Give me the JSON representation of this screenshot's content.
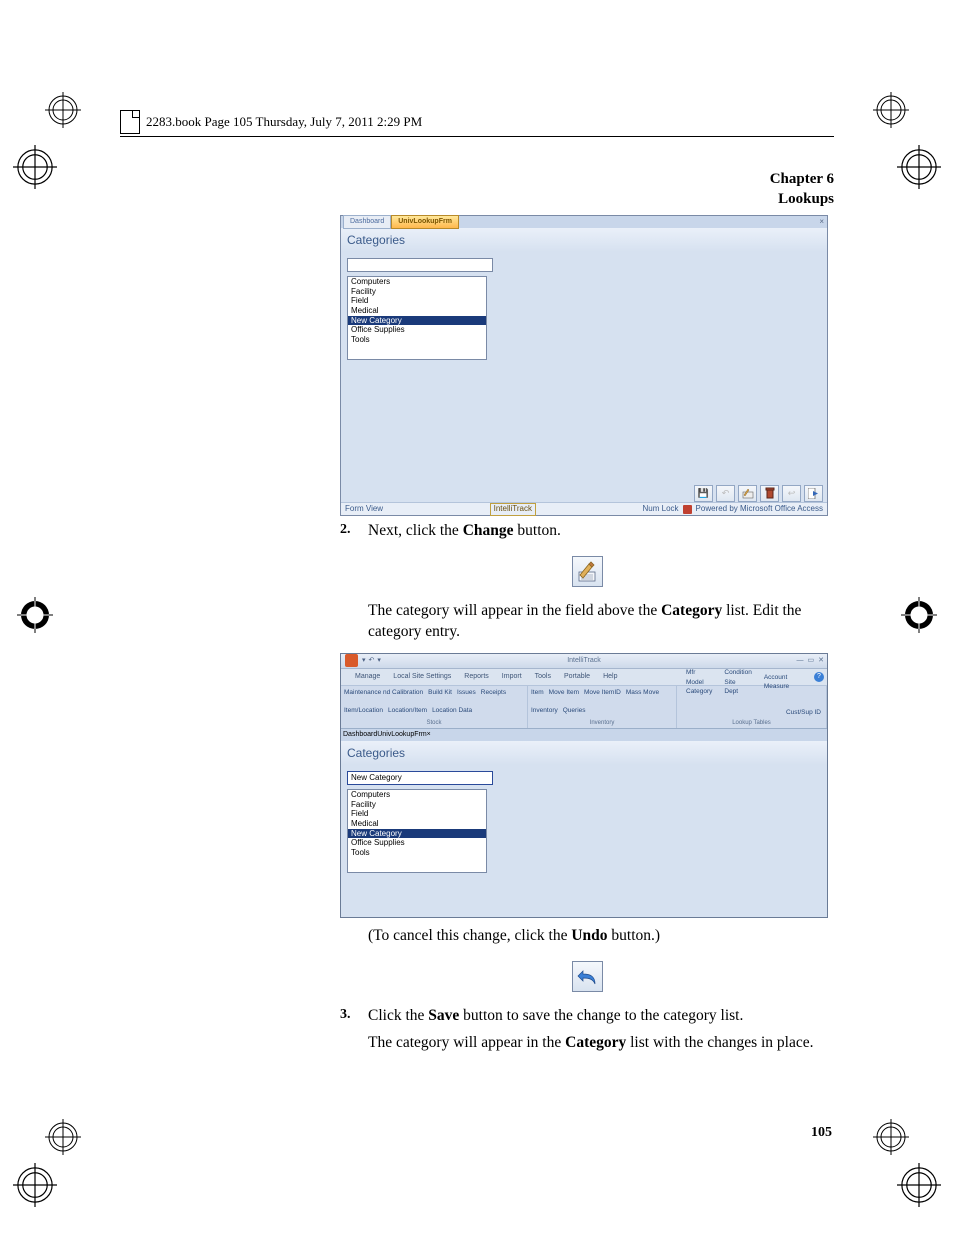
{
  "book_header": "2283.book  Page 105  Thursday, July 7, 2011  2:29 PM",
  "chapter": {
    "line1": "Chapter 6",
    "line2": "Lookups"
  },
  "page_number": "105",
  "screenshot1": {
    "tab_dashboard": "Dashboard",
    "tab_active": "UnivLookupFrm",
    "title": "Categories",
    "list": [
      "Computers",
      "Facility",
      "Field",
      "Medical",
      "New Category",
      "Office Supplies",
      "Tools"
    ],
    "selected_index": 4,
    "status_left": "Form View",
    "status_mid": "IntelliTrack",
    "status_numlock": "Num Lock",
    "status_powered": "Powered by Microsoft Office Access"
  },
  "step2": {
    "num": "2.",
    "text_pre": "Next, click the ",
    "text_bold": "Change",
    "text_post": " button.",
    "paragraph_pre": "The category will appear in the field above the ",
    "paragraph_bold": "Category",
    "paragraph_post": " list. Edit the category entry."
  },
  "screenshot2": {
    "app_title": "IntelliTrack",
    "menus": [
      "Manage",
      "Local Site Settings",
      "Reports",
      "Import",
      "Tools",
      "Portable",
      "Help"
    ],
    "ribbon": {
      "grp1": {
        "items": [
          "Maintenance nd Calibration",
          "Build Kit",
          "Issues",
          "Receipts",
          "Item/Location",
          "Location/Item",
          "Location Data"
        ],
        "name": "Stock"
      },
      "grp2": {
        "items": [
          "Item",
          "Move Item",
          "Move ItemID",
          "Mass Move",
          "Inventory",
          "Queries"
        ],
        "name": "Inventory"
      },
      "grp3": {
        "col1": [
          "Mfr",
          "Model",
          "Category"
        ],
        "col2": [
          "Condition",
          "Site",
          "Dept"
        ],
        "col3": [
          "Account",
          "Measure"
        ],
        "edge": "Cust/Sup ID",
        "name": "Lookup Tables"
      }
    },
    "tab_dashboard": "Dashboard",
    "tab_active": "UnivLookupFrm",
    "title": "Categories",
    "input_value": "New Category",
    "list": [
      "Computers",
      "Facility",
      "Field",
      "Medical",
      "New Category",
      "Office Supplies",
      "Tools"
    ],
    "selected_index": 4
  },
  "cancel_text": {
    "pre": "(To cancel this change, click the ",
    "bold": "Undo",
    "post": " button.)"
  },
  "step3": {
    "num": "3.",
    "text_pre": "Click the ",
    "text_bold": "Save",
    "text_post": " button to save the change to the category list.",
    "para2_pre": "The category will appear in the ",
    "para2_bold": "Category",
    "para2_post": " list with the changes in place."
  }
}
